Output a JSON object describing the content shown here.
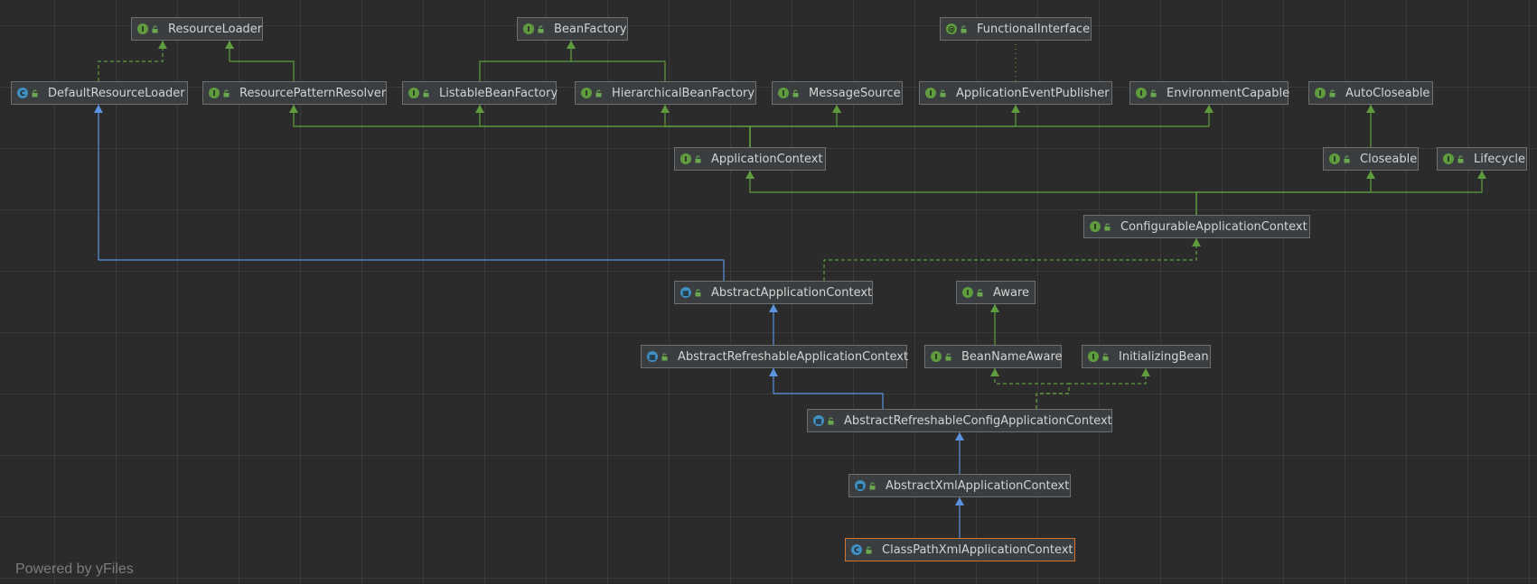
{
  "footer": "Powered by yFiles",
  "nodes": [
    {
      "id": "ResourceLoader",
      "label": "ResourceLoader",
      "kind": "interface"
    },
    {
      "id": "BeanFactory",
      "label": "BeanFactory",
      "kind": "interface"
    },
    {
      "id": "FunctionalInterface",
      "label": "FunctionalInterface",
      "kind": "annotation"
    },
    {
      "id": "DefaultResourceLoader",
      "label": "DefaultResourceLoader",
      "kind": "class"
    },
    {
      "id": "ResourcePatternResolver",
      "label": "ResourcePatternResolver",
      "kind": "interface"
    },
    {
      "id": "ListableBeanFactory",
      "label": "ListableBeanFactory",
      "kind": "interface"
    },
    {
      "id": "HierarchicalBeanFactory",
      "label": "HierarchicalBeanFactory",
      "kind": "interface"
    },
    {
      "id": "MessageSource",
      "label": "MessageSource",
      "kind": "interface"
    },
    {
      "id": "ApplicationEventPublisher",
      "label": "ApplicationEventPublisher",
      "kind": "interface"
    },
    {
      "id": "EnvironmentCapable",
      "label": "EnvironmentCapable",
      "kind": "interface"
    },
    {
      "id": "AutoCloseable",
      "label": "AutoCloseable",
      "kind": "interface"
    },
    {
      "id": "ApplicationContext",
      "label": "ApplicationContext",
      "kind": "interface"
    },
    {
      "id": "Closeable",
      "label": "Closeable",
      "kind": "interface"
    },
    {
      "id": "Lifecycle",
      "label": "Lifecycle",
      "kind": "interface"
    },
    {
      "id": "ConfigurableApplicationContext",
      "label": "ConfigurableApplicationContext",
      "kind": "interface"
    },
    {
      "id": "AbstractApplicationContext",
      "label": "AbstractApplicationContext",
      "kind": "abstract"
    },
    {
      "id": "Aware",
      "label": "Aware",
      "kind": "interface"
    },
    {
      "id": "AbstractRefreshableApplicationContext",
      "label": "AbstractRefreshableApplicationContext",
      "kind": "abstract"
    },
    {
      "id": "BeanNameAware",
      "label": "BeanNameAware",
      "kind": "interface"
    },
    {
      "id": "InitializingBean",
      "label": "InitializingBean",
      "kind": "interface"
    },
    {
      "id": "AbstractRefreshableConfigApplicationContext",
      "label": "AbstractRefreshableConfigApplicationContext",
      "kind": "abstract"
    },
    {
      "id": "AbstractXmlApplicationContext",
      "label": "AbstractXmlApplicationContext",
      "kind": "abstract"
    },
    {
      "id": "ClassPathXmlApplicationContext",
      "label": "ClassPathXmlApplicationContext",
      "kind": "class",
      "selected": true
    }
  ],
  "edges": [
    {
      "from": "DefaultResourceLoader",
      "to": "ResourceLoader",
      "type": "implements"
    },
    {
      "from": "ResourcePatternResolver",
      "to": "ResourceLoader",
      "type": "extends-interface"
    },
    {
      "from": "ListableBeanFactory",
      "to": "BeanFactory",
      "type": "extends-interface"
    },
    {
      "from": "HierarchicalBeanFactory",
      "to": "BeanFactory",
      "type": "extends-interface"
    },
    {
      "from": "ApplicationEventPublisher",
      "to": "FunctionalInterface",
      "type": "annotation"
    },
    {
      "from": "ApplicationContext",
      "to": "ResourcePatternResolver",
      "type": "extends-interface"
    },
    {
      "from": "ApplicationContext",
      "to": "ListableBeanFactory",
      "type": "extends-interface"
    },
    {
      "from": "ApplicationContext",
      "to": "HierarchicalBeanFactory",
      "type": "extends-interface"
    },
    {
      "from": "ApplicationContext",
      "to": "MessageSource",
      "type": "extends-interface"
    },
    {
      "from": "ApplicationContext",
      "to": "ApplicationEventPublisher",
      "type": "extends-interface"
    },
    {
      "from": "ApplicationContext",
      "to": "EnvironmentCapable",
      "type": "extends-interface"
    },
    {
      "from": "Closeable",
      "to": "AutoCloseable",
      "type": "extends-interface"
    },
    {
      "from": "ConfigurableApplicationContext",
      "to": "ApplicationContext",
      "type": "extends-interface"
    },
    {
      "from": "ConfigurableApplicationContext",
      "to": "Closeable",
      "type": "extends-interface"
    },
    {
      "from": "ConfigurableApplicationContext",
      "to": "Lifecycle",
      "type": "extends-interface"
    },
    {
      "from": "AbstractApplicationContext",
      "to": "DefaultResourceLoader",
      "type": "extends"
    },
    {
      "from": "AbstractApplicationContext",
      "to": "ConfigurableApplicationContext",
      "type": "implements"
    },
    {
      "from": "BeanNameAware",
      "to": "Aware",
      "type": "extends-interface"
    },
    {
      "from": "AbstractRefreshableApplicationContext",
      "to": "AbstractApplicationContext",
      "type": "extends"
    },
    {
      "from": "AbstractRefreshableConfigApplicationContext",
      "to": "AbstractRefreshableApplicationContext",
      "type": "extends"
    },
    {
      "from": "AbstractRefreshableConfigApplicationContext",
      "to": "BeanNameAware",
      "type": "implements"
    },
    {
      "from": "AbstractRefreshableConfigApplicationContext",
      "to": "InitializingBean",
      "type": "implements"
    },
    {
      "from": "AbstractXmlApplicationContext",
      "to": "AbstractRefreshableConfigApplicationContext",
      "type": "extends"
    },
    {
      "from": "ClassPathXmlApplicationContext",
      "to": "AbstractXmlApplicationContext",
      "type": "extends"
    }
  ],
  "colors": {
    "interface_edge": "#5e9c3e",
    "class_edge": "#5b93e0",
    "annotation_edge": "#7a8a3a",
    "selected_border": "#d0752f"
  }
}
